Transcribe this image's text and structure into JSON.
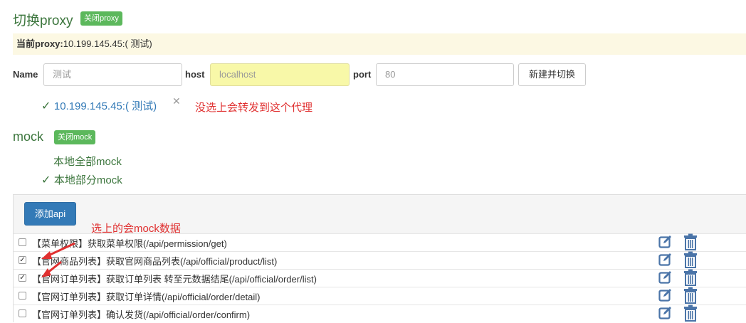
{
  "proxy": {
    "title": "切换proxy",
    "toggle_label": "关闭proxy",
    "current_label": "当前proxy:",
    "current_value": "10.199.145.45:( 测试)",
    "form": {
      "name_label": "Name",
      "name_placeholder": "测试",
      "host_label": "host",
      "host_placeholder": "localhost",
      "port_label": "port",
      "port_placeholder": "80",
      "submit_label": "新建并切换"
    },
    "list": [
      {
        "label": "10.199.145.45:( 测试)",
        "checked": true
      }
    ],
    "annotation": "没选上会转发到这个代理"
  },
  "mock": {
    "title": "mock",
    "toggle_label": "关闭mock",
    "options": [
      {
        "label": "本地全部mock",
        "checked": false
      },
      {
        "label": "本地部分mock",
        "checked": true
      }
    ],
    "add_button": "添加api",
    "annotation": "选上的会mock数据",
    "apis": [
      {
        "label": "【菜单权限】获取菜单权限(/api/permission/get)",
        "checked": false
      },
      {
        "label": "【官网商品列表】获取官网商品列表(/api/official/product/list)",
        "checked": true
      },
      {
        "label": "【官网订单列表】获取订单列表 转至元数据结尾(/api/official/order/list)",
        "checked": true
      },
      {
        "label": "【官网订单列表】获取订单详情(/api/official/order/detail)",
        "checked": false
      },
      {
        "label": "【官网订单列表】确认发货(/api/official/order/confirm)",
        "checked": false
      }
    ]
  },
  "colors": {
    "accent_green": "#3c763d",
    "badge_green": "#5cb85c",
    "primary_blue": "#337ab7",
    "icon_blue": "#4a74a8",
    "annotation_red": "#e03030",
    "warning_bg": "#fcf8e3"
  }
}
